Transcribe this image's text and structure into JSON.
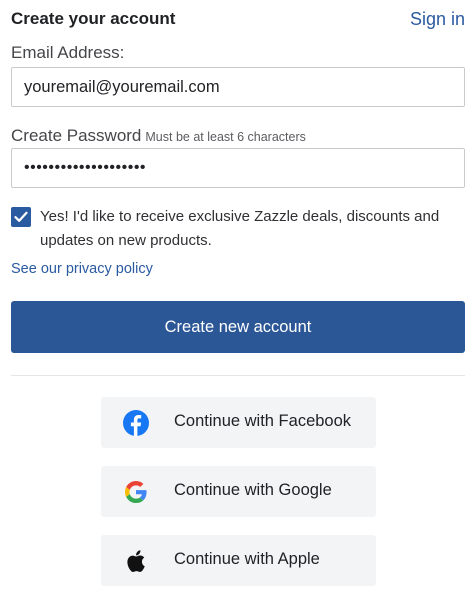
{
  "header": {
    "title": "Create your account",
    "signin_label": "Sign in"
  },
  "email": {
    "label": "Email Address:",
    "value": "youremail@youremail.com"
  },
  "password": {
    "label": "Create Password",
    "hint": "Must be at least 6 characters",
    "value": "••••••••••••••••••••"
  },
  "consent": {
    "checked": true,
    "text": "Yes! I'd like to receive exclusive Zazzle deals, discounts and updates on new products."
  },
  "privacy_link": "See our privacy policy",
  "create_button": "Create new account",
  "social": {
    "facebook": "Continue with Facebook",
    "google": "Continue with Google",
    "apple": "Continue with Apple"
  },
  "colors": {
    "accent": "#2b5797",
    "link": "#2a5aa0",
    "facebook": "#1877f2"
  },
  "icons": {
    "checkbox": "checkmark-icon",
    "facebook": "facebook-icon",
    "google": "google-icon",
    "apple": "apple-icon"
  }
}
